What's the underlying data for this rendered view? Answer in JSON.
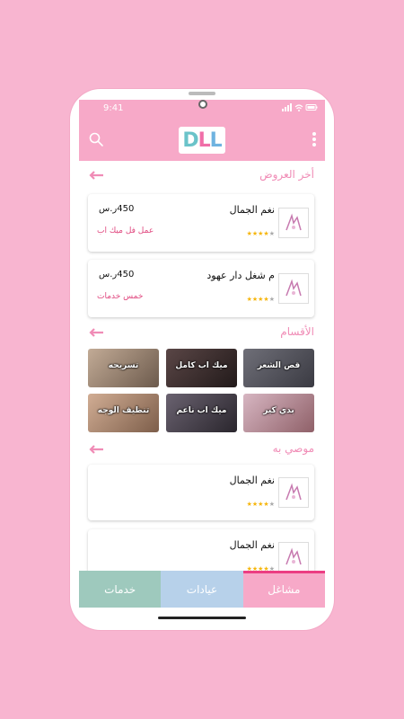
{
  "status": {
    "time": "9:41"
  },
  "app": {
    "logo_text": {
      "d": "D",
      "l1": "L",
      "l2": "L"
    }
  },
  "offers": {
    "title": "أخر العروض",
    "items": [
      {
        "name": "نغم الجمال",
        "price": "450ر.س",
        "desc": "عمل فل ميك اب",
        "rating": 4
      },
      {
        "name": "م شغل دار عهود",
        "price": "450ر.س",
        "desc": "خمس خدمات",
        "rating": 4
      }
    ]
  },
  "categories": {
    "title": "الأقسام",
    "items": [
      {
        "label": "قص الشعر",
        "color": "#4a4a52"
      },
      {
        "label": "ميك اب كامل",
        "color": "#3a2f2f"
      },
      {
        "label": "تسريحه",
        "color": "#8b7766"
      },
      {
        "label": "بدي كير",
        "color": "#b88e8e"
      },
      {
        "label": "ميك اب ناعم",
        "color": "#3e3a3f"
      },
      {
        "label": "تنظيف الوجه",
        "color": "#a68670"
      }
    ]
  },
  "recommended": {
    "title": "موصي به",
    "items": [
      {
        "name": "نغم الجمال",
        "rating": 4
      },
      {
        "name": "نغم الجمال",
        "rating": 4
      }
    ]
  },
  "tabs": [
    {
      "label": "مشاغل",
      "color": "#f7a9c8",
      "active": true
    },
    {
      "label": "عيادات",
      "color": "#b7d1ea",
      "active": false
    },
    {
      "label": "خدمات",
      "color": "#9ec9bd",
      "active": false
    }
  ],
  "icons": {
    "search": "search-icon",
    "menu": "more-vertical-icon",
    "back": "arrow-left-icon",
    "star": "star-icon"
  }
}
